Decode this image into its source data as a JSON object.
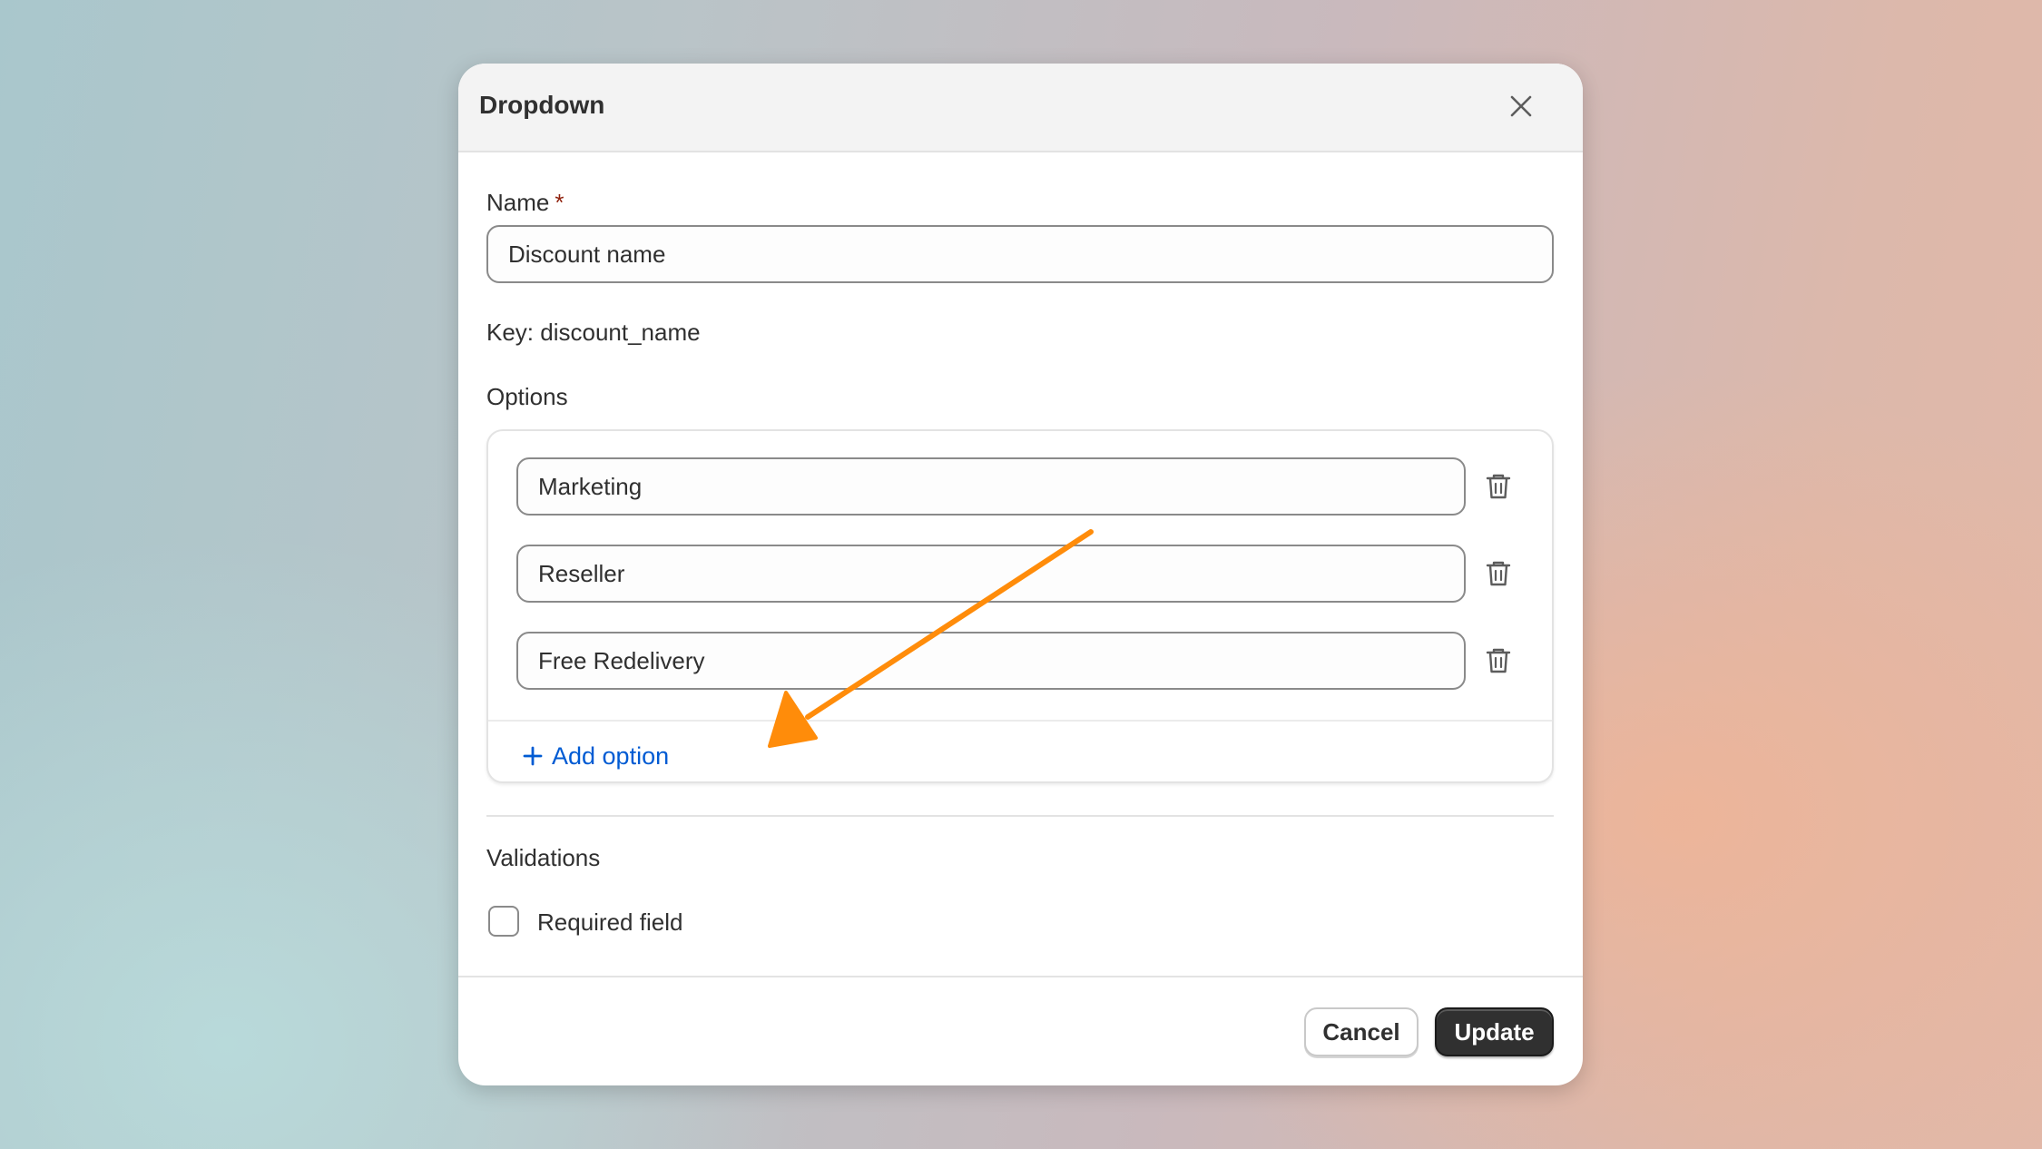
{
  "modal": {
    "title": "Dropdown",
    "close_icon": "close-icon"
  },
  "name_field": {
    "label": "Name",
    "required_marker": "*",
    "value": "Discount name"
  },
  "key_text": "Key: discount_name",
  "options": {
    "label": "Options",
    "items": [
      {
        "value": "Marketing",
        "icon": "trash-icon"
      },
      {
        "value": "Reseller",
        "icon": "trash-icon"
      },
      {
        "value": "Free Redelivery",
        "icon": "trash-icon"
      }
    ],
    "add_label": "Add option",
    "add_icon": "plus-icon"
  },
  "validations": {
    "label": "Validations",
    "required_field_label": "Required field",
    "required_checked": false
  },
  "footer": {
    "cancel_label": "Cancel",
    "update_label": "Update"
  },
  "colors": {
    "link_blue": "#005bd3",
    "primary_button": "#303030",
    "required_star": "#8e1f0b",
    "annotation_arrow": "#ff8c0a"
  }
}
